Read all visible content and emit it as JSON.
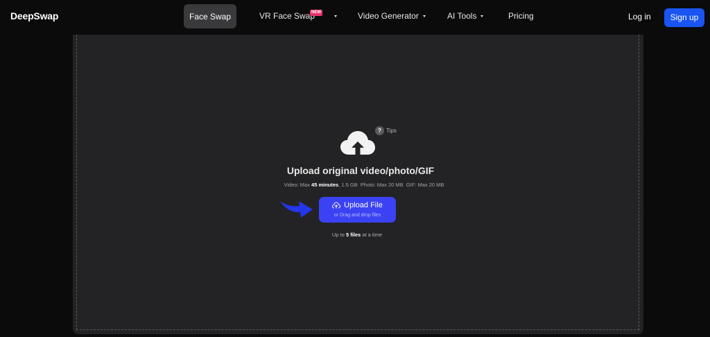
{
  "nav": {
    "logo": "DeepSwap",
    "items": [
      {
        "label": "Face Swap",
        "active": true
      },
      {
        "label": "VR Face Swap",
        "badge": "NEW",
        "dropdown": true
      },
      {
        "label": "Video Generator",
        "dropdown": true
      },
      {
        "label": "AI Tools",
        "dropdown": true
      },
      {
        "label": "Pricing"
      }
    ],
    "login": "Log in",
    "signup": "Sign up"
  },
  "upload": {
    "tips": "Tips",
    "title": "Upload original video/photo/GIF",
    "limits": {
      "video_prefix": "Video: Max ",
      "video_duration": "45 minutes",
      "video_size": ", 1.5 GB",
      "photo": "Photo: Max 20 MB",
      "gif": "GIF: Max 20 MB"
    },
    "button_label": "Upload File",
    "button_sub": "or Drag and drop files",
    "files_prefix": "Up to ",
    "files_count": "5 files",
    "files_suffix": " at a time"
  },
  "colors": {
    "accent": "#3b42f4",
    "signup": "#1a55f2",
    "badge": "#e8316a",
    "panel": "#232325"
  },
  "icons": [
    "cloud-upload-icon",
    "question-icon",
    "pointer-arrow-icon",
    "caret-down-icon"
  ]
}
